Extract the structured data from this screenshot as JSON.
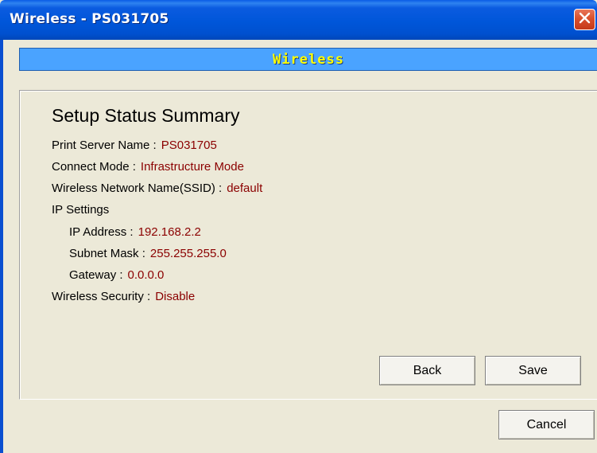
{
  "window": {
    "title": "Wireless - PS031705",
    "close_icon": "close-icon"
  },
  "header": {
    "label": "Wireless"
  },
  "summary": {
    "title": "Setup Status Summary",
    "print_server_name": {
      "label": "Print Server Name :",
      "value": "PS031705"
    },
    "connect_mode": {
      "label": "Connect Mode :",
      "value": "Infrastructure Mode"
    },
    "ssid": {
      "label": "Wireless Network Name(SSID) :",
      "value": "default"
    },
    "ip_settings_label": "IP Settings",
    "ip_address": {
      "label": "IP Address :",
      "value": "192.168.2.2"
    },
    "subnet_mask": {
      "label": "Subnet Mask :",
      "value": "255.255.255.0"
    },
    "gateway": {
      "label": "Gateway :",
      "value": "0.0.0.0"
    },
    "wireless_security": {
      "label": "Wireless Security :",
      "value": "Disable"
    }
  },
  "buttons": {
    "back": "Back",
    "save": "Save",
    "cancel": "Cancel"
  },
  "colors": {
    "titlebar": "#0054e3",
    "header_bar": "#4aa3ff",
    "header_text": "#ffff00",
    "value_text": "#8b0000",
    "dialog_bg": "#ece9d8"
  }
}
